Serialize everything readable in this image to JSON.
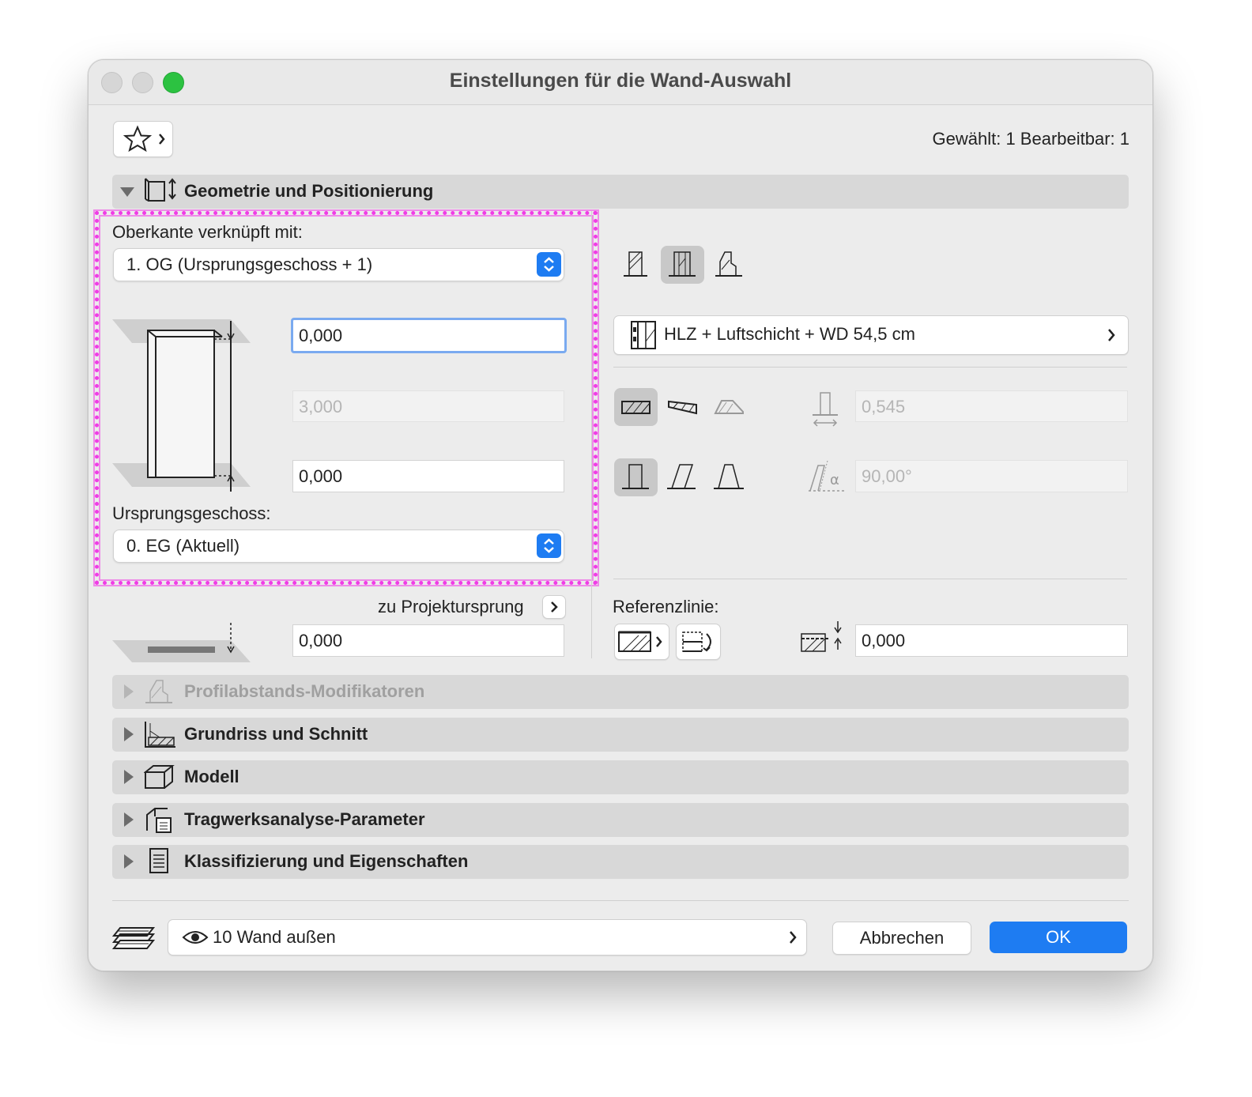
{
  "window": {
    "title": "Einstellungen für die Wand-Auswahl",
    "selection_info": "Gewählt: 1 Bearbeitbar: 1"
  },
  "sections": {
    "geometry": "Geometrie und Positionierung",
    "profile": "Profilabstands-Modifikatoren",
    "floorplan": "Grundriss und Schnitt",
    "model": "Modell",
    "structural": "Tragwerksanalyse-Parameter",
    "classification": "Klassifizierung und Eigenschaften"
  },
  "geometry": {
    "top_link_label": "Oberkante verknüpft mit:",
    "top_link_value": "1. OG (Ursprungsgeschoss + 1)",
    "top_offset": "0,000",
    "height": "3,000",
    "bottom_offset": "0,000",
    "home_story_label": "Ursprungsgeschoss:",
    "home_story_value": "0. EG (Aktuell)",
    "project_zero_label": "zu Projektursprung",
    "project_zero_value": "0,000",
    "composite": "HLZ + Luftschicht + WD 54,5 cm",
    "thickness": "0,545",
    "angle": "90,00°",
    "reference_line_label": "Referenzlinie:",
    "reference_offset": "0,000"
  },
  "footer": {
    "layer": "10 Wand außen",
    "cancel": "Abbrechen",
    "ok": "OK"
  },
  "colors": {
    "accent": "#1e7cf2",
    "highlight": "#f03ce6",
    "close": "#d0d0d0",
    "zoom": "#2cc241"
  }
}
